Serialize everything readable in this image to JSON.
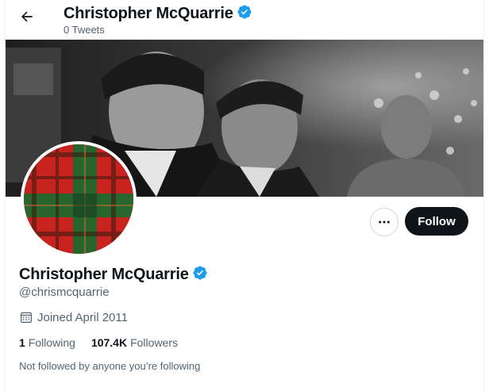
{
  "header": {
    "back_icon": "arrow-left-icon",
    "name": "Christopher McQuarrie",
    "tweet_count": "0 Tweets",
    "verified_icon": "verified-badge-icon"
  },
  "banner": {
    "description_icon": "banner-photo",
    "tone": "black-and-white"
  },
  "avatar": {
    "pattern": "red-tartan",
    "colors": {
      "red": "#c8231f",
      "green": "#1f6a2e",
      "dark": "#3a1a12"
    }
  },
  "actions": {
    "more_icon": "more-horizontal-icon",
    "follow_label": "Follow"
  },
  "profile": {
    "name": "Christopher McQuarrie",
    "handle": "@chrismcquarrie",
    "calendar_icon": "calendar-icon",
    "joined": "Joined April 2011",
    "following_count": "1",
    "following_label": "Following",
    "followers_count": "107.4K",
    "followers_label": "Followers",
    "not_followed_text": "Not followed by anyone you’re following"
  },
  "colors": {
    "verified_blue": "#1d9bf0",
    "text_primary": "#0f1419",
    "text_secondary": "#536471",
    "follow_bg": "#0f1419"
  }
}
